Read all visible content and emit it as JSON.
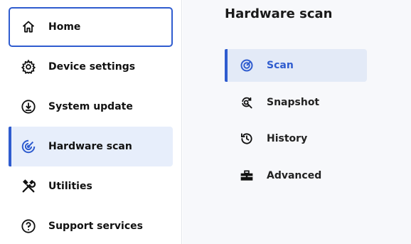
{
  "sidebar": {
    "items": [
      {
        "label": "Home",
        "icon": "home-icon"
      },
      {
        "label": "Device settings",
        "icon": "gear-icon"
      },
      {
        "label": "System update",
        "icon": "download-icon"
      },
      {
        "label": "Hardware scan",
        "icon": "scan-icon"
      },
      {
        "label": "Utilities",
        "icon": "tools-icon"
      },
      {
        "label": "Support services",
        "icon": "help-icon"
      }
    ],
    "focused_item": "Home",
    "active_item": "Hardware scan"
  },
  "main": {
    "title": "Hardware scan",
    "tabs": [
      {
        "label": "Scan",
        "icon": "scan-icon"
      },
      {
        "label": "Snapshot",
        "icon": "snapshot-icon"
      },
      {
        "label": "History",
        "icon": "history-icon"
      },
      {
        "label": "Advanced",
        "icon": "toolbox-icon"
      }
    ],
    "active_tab": "Scan"
  },
  "colors": {
    "accent": "#2f5ccf",
    "active_bg": "#e7eefb",
    "main_bg": "#f7f8fb",
    "text": "#111111"
  }
}
